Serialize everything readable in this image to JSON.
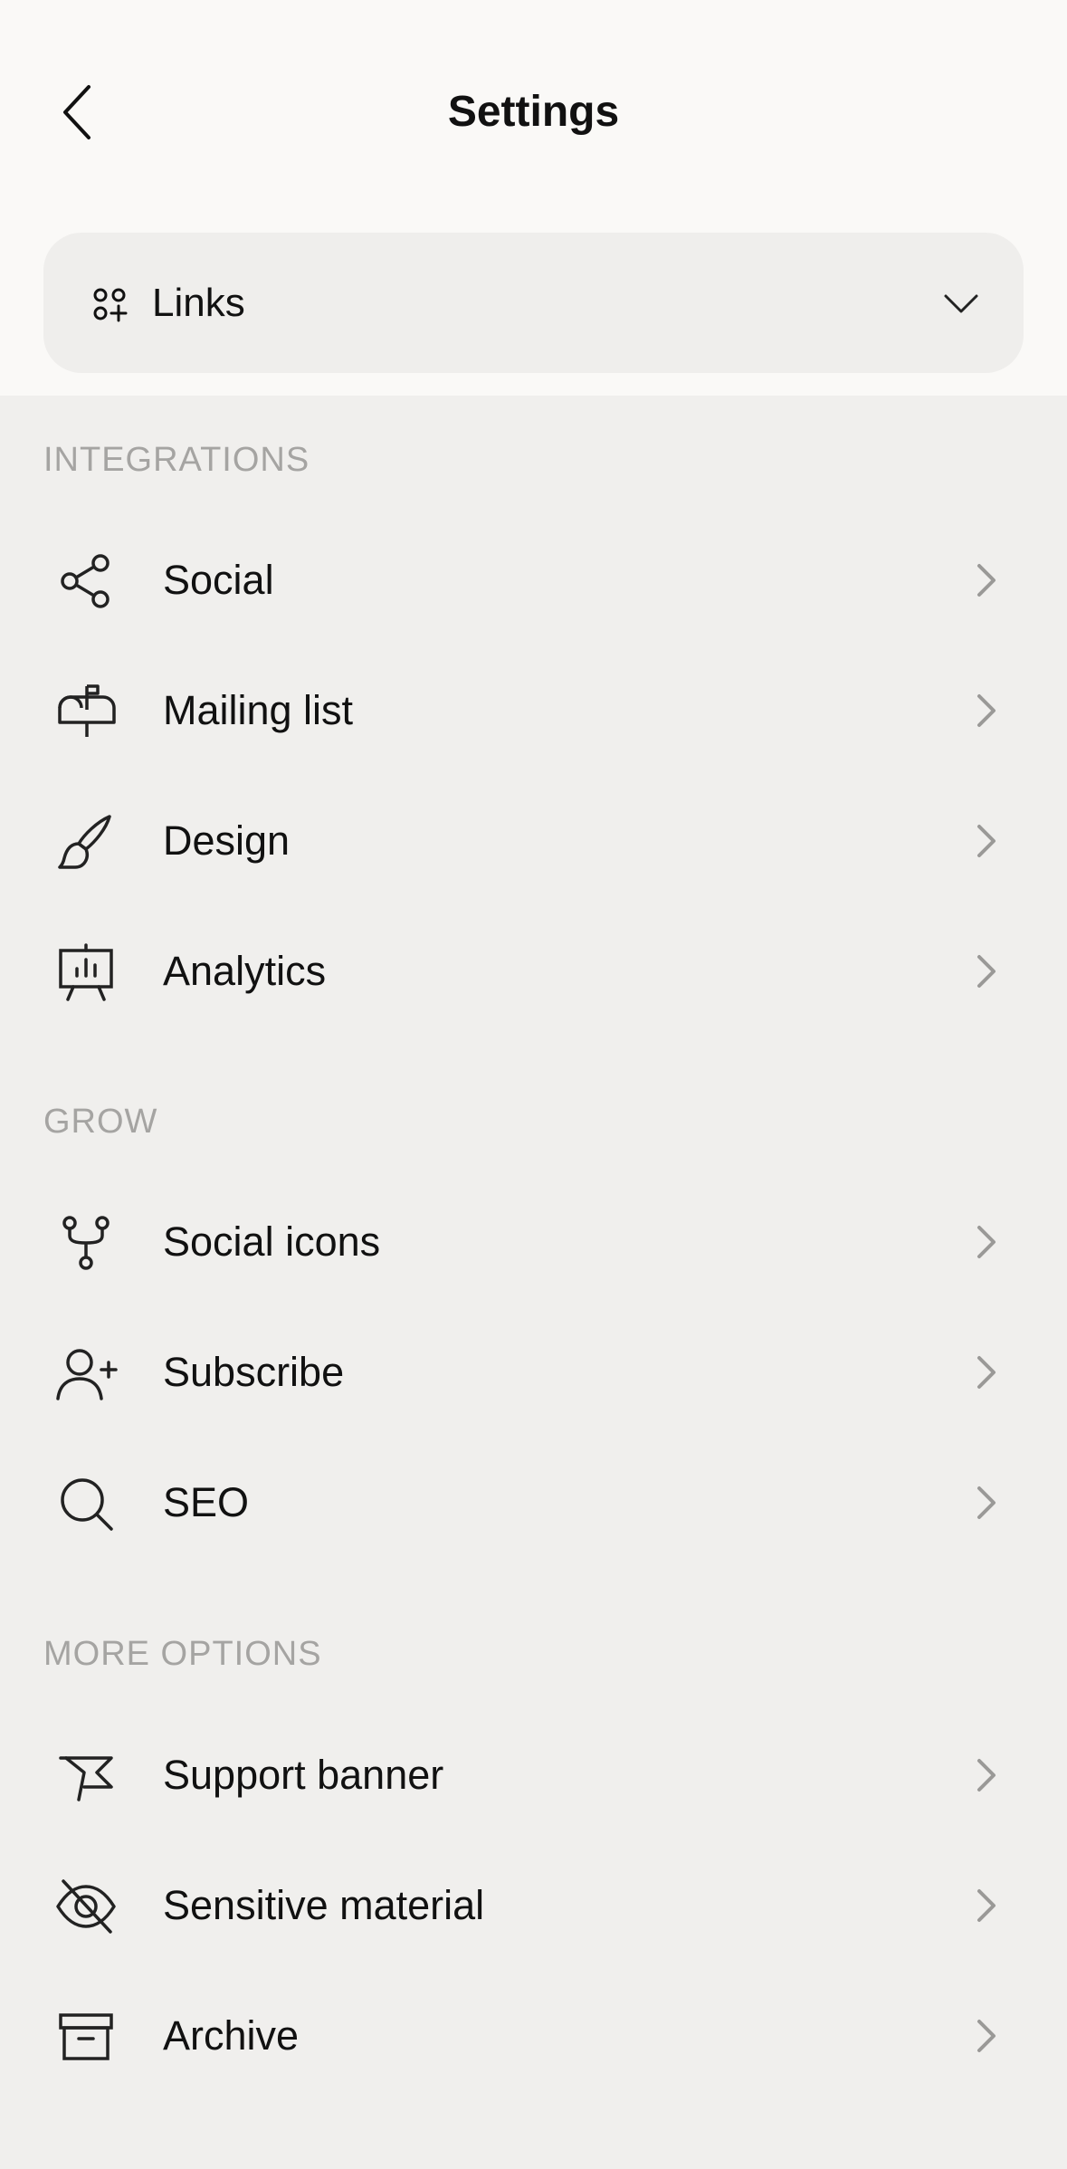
{
  "header": {
    "title": "Settings"
  },
  "selector": {
    "label": "Links",
    "icon": "apps-plus-icon"
  },
  "sections": [
    {
      "title": "INTEGRATIONS",
      "items": [
        {
          "label": "Social",
          "icon": "share-icon"
        },
        {
          "label": "Mailing list",
          "icon": "mailbox-icon"
        },
        {
          "label": "Design",
          "icon": "brush-icon"
        },
        {
          "label": "Analytics",
          "icon": "presentation-chart-icon"
        }
      ]
    },
    {
      "title": "GROW",
      "items": [
        {
          "label": "Social icons",
          "icon": "fork-icon"
        },
        {
          "label": "Subscribe",
          "icon": "user-plus-icon"
        },
        {
          "label": "SEO",
          "icon": "search-icon"
        }
      ]
    },
    {
      "title": "MORE OPTIONS",
      "items": [
        {
          "label": "Support banner",
          "icon": "banner-flag-icon"
        },
        {
          "label": "Sensitive material",
          "icon": "eye-off-icon"
        },
        {
          "label": "Archive",
          "icon": "archive-box-icon"
        }
      ]
    }
  ],
  "colors": {
    "header_bg": "#faf9f7",
    "page_bg": "#f0efed",
    "section_title": "#a5a4a2",
    "chevron": "#9a9997"
  }
}
